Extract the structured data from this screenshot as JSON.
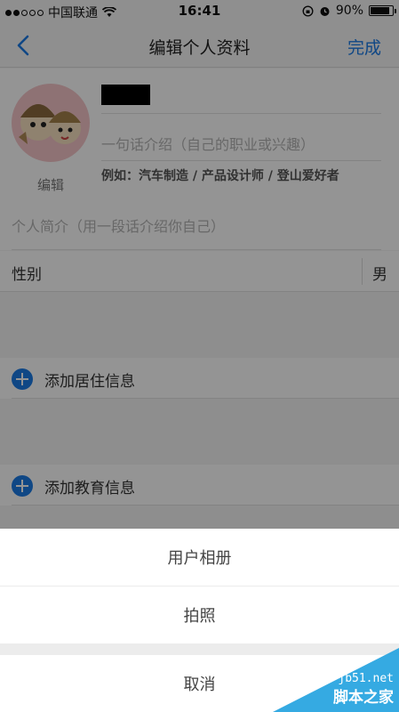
{
  "status_bar": {
    "carrier": "中国联通",
    "time": "16:41",
    "battery": "90%",
    "battery_level": 0.9
  },
  "nav": {
    "title": "编辑个人资料",
    "done_label": "完成"
  },
  "profile": {
    "avatar_label": "编辑",
    "intro_placeholder": "一句话介绍（自己的职业或兴趣）",
    "intro_example": "例如：汽车制造 / 产品设计师 / 登山爱好者",
    "bio_placeholder": "个人简介（用一段话介绍你自己）"
  },
  "gender": {
    "label": "性别",
    "value": "男"
  },
  "add_residence_label": "添加居住信息",
  "add_education_label": "添加教育信息",
  "action_sheet": {
    "album_label": "用户相册",
    "photo_label": "拍照",
    "cancel_label": "取消"
  },
  "watermark": {
    "site": "jb51.net",
    "name": "脚本之家"
  },
  "colors": {
    "accent": "#1a7ae6",
    "avatar_bg": "#f4c5c8",
    "watermark": "#2aa5e0"
  }
}
